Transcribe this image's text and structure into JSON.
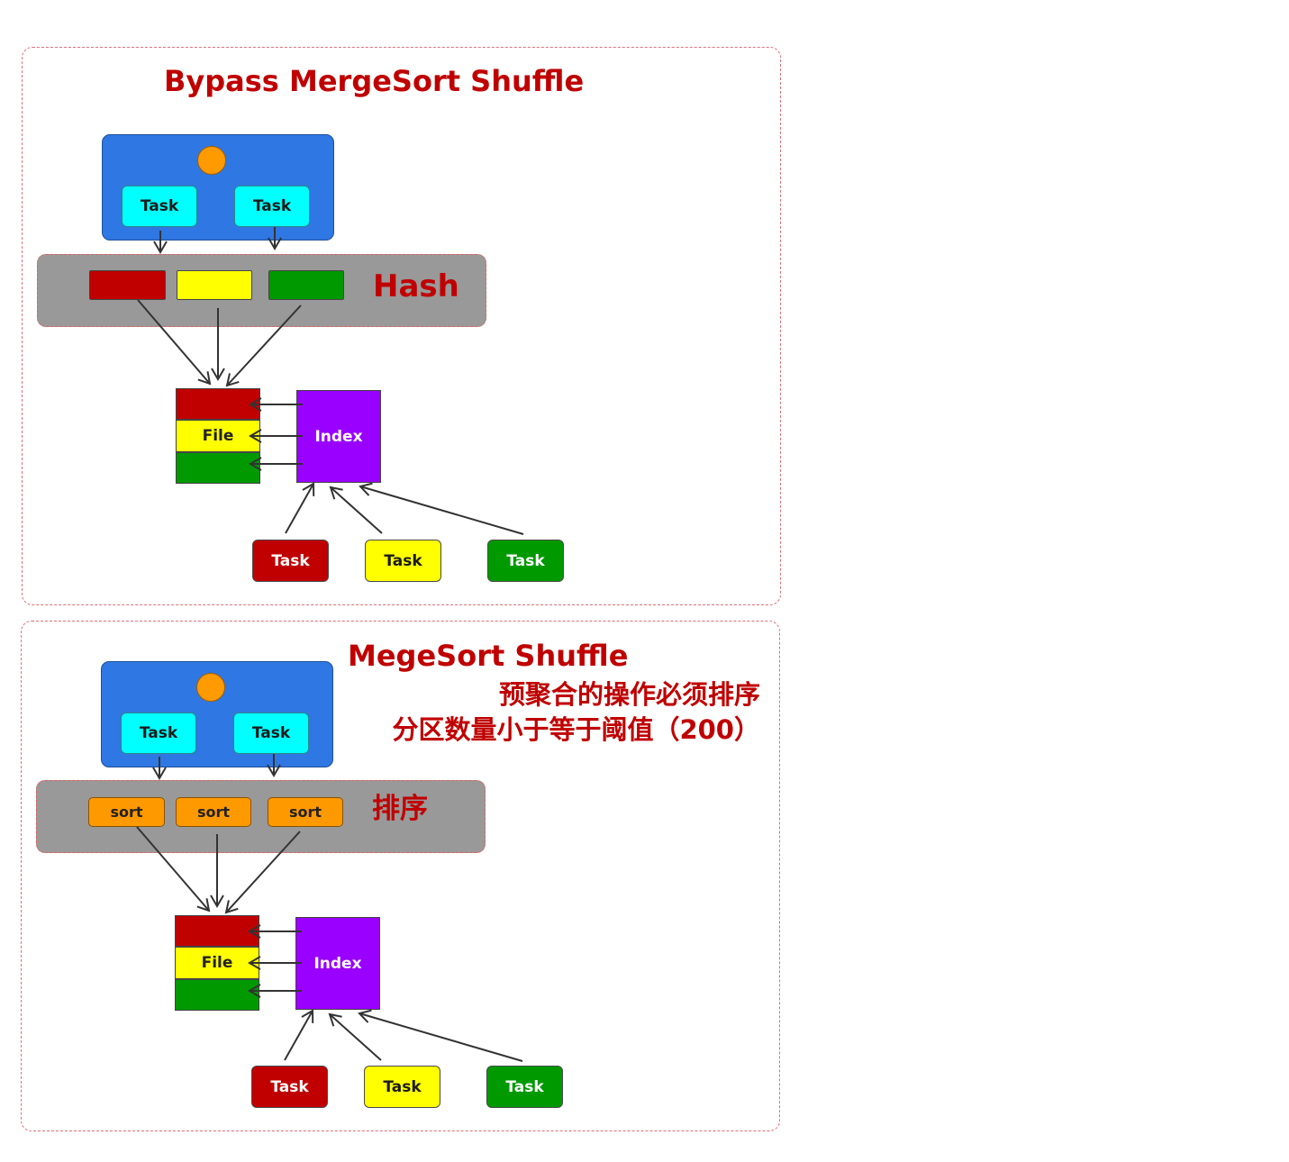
{
  "section1": {
    "title": "Bypass MergeSort Shuffle",
    "executor_tasks": [
      "Task",
      "Task"
    ],
    "band_label": "Hash",
    "buckets": [
      "red",
      "yellow",
      "green"
    ],
    "file_label": "File",
    "index_label": "Index",
    "reduce_tasks": [
      "Task",
      "Task",
      "Task"
    ]
  },
  "section2": {
    "title": "MegeSort Shuffle",
    "note_line1": "预聚合的操作必须排序",
    "note_line2": "分区数量小于等于阈值（200）",
    "executor_tasks": [
      "Task",
      "Task"
    ],
    "band_label": "排序",
    "sort_labels": [
      "sort",
      "sort",
      "sort"
    ],
    "file_label": "File",
    "index_label": "Index",
    "reduce_tasks": [
      "Task",
      "Task",
      "Task"
    ]
  },
  "colors": {
    "title": "#c00000",
    "executor": "#2f77e2",
    "task_cyan": "#00ffff",
    "band": "#999999",
    "red": "#c00000",
    "yellow": "#ffff00",
    "green": "#009900",
    "index": "#9900ff",
    "sort": "#ff9900"
  }
}
